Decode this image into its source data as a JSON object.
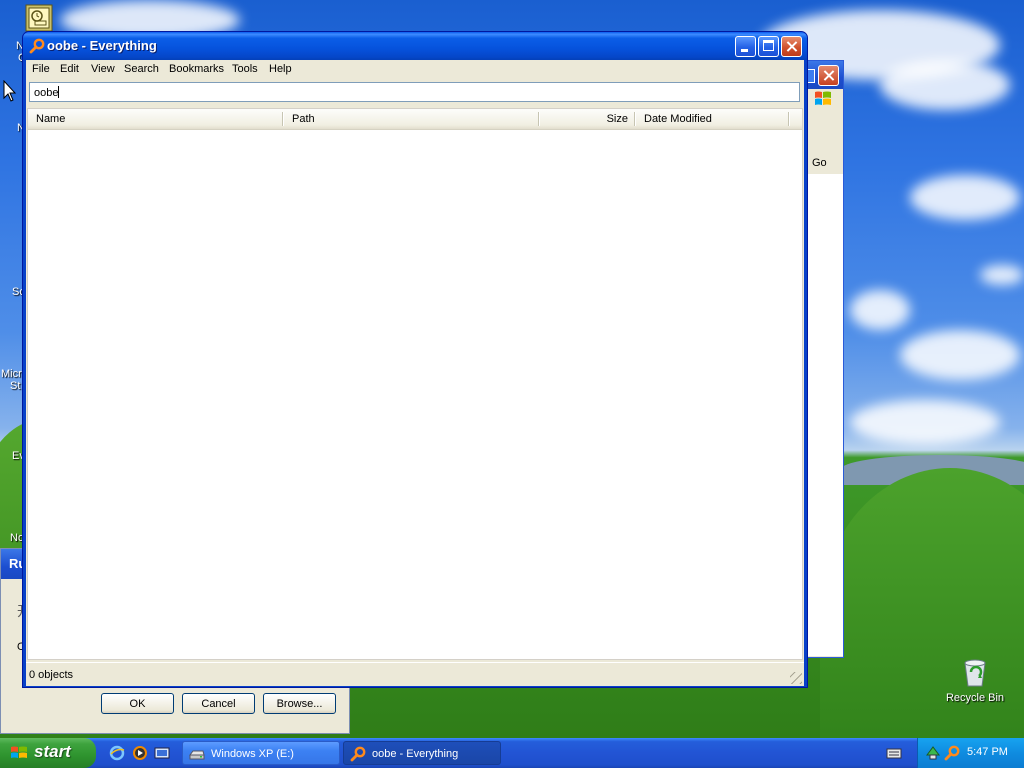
{
  "desktop": {
    "recycle_bin_label": "Recycle Bin",
    "partial_labels": [
      "N",
      "C",
      "N",
      "Sc",
      "Micr",
      "St",
      "Ev",
      "No"
    ]
  },
  "run_dialog": {
    "title": "Ru",
    "body_chars": [
      "开",
      "O"
    ],
    "ok_label": "OK",
    "cancel_label": "Cancel",
    "browse_label": "Browse..."
  },
  "explorer_window": {
    "go_label": "Go"
  },
  "window": {
    "title": "oobe - Everything",
    "menu": [
      "File",
      "Edit",
      "View",
      "Search",
      "Bookmarks",
      "Tools",
      "Help"
    ],
    "search_value": "oobe",
    "columns": [
      "Name",
      "Path",
      "Size",
      "Date Modified"
    ],
    "rows": [],
    "status": "0 objects"
  },
  "taskbar": {
    "start_label": "start",
    "tasks": [
      {
        "label": "Windows XP (E:)",
        "icon": "drive-icon",
        "active": false
      },
      {
        "label": "oobe - Everything",
        "icon": "everything-icon",
        "active": true
      }
    ],
    "clock": "5:47 PM"
  },
  "colors": {
    "title_blue": "#0652dc",
    "taskbar_blue": "#245edb",
    "start_green": "#3ea33e",
    "tray_blue": "#0f8ce0",
    "dialog_face": "#ece9d8"
  }
}
